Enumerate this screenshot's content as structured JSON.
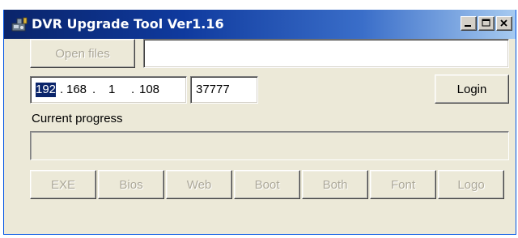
{
  "window": {
    "title": "DVR Upgrade Tool Ver1.16",
    "app_icon": "dvr-tool-icon",
    "title_bar_color": "#0a246a"
  },
  "controls": {
    "open_files_label": "Open files",
    "open_files_enabled": false,
    "file_path_value": "",
    "ip_address": {
      "octets": [
        "192",
        "168",
        "1",
        "108"
      ],
      "selected_octet": 0
    },
    "port_value": "37777",
    "login_label": "Login",
    "progress_label": "Current progress",
    "progress_value": 0
  },
  "upgrade_buttons": [
    {
      "label": "EXE",
      "enabled": false
    },
    {
      "label": "Bios",
      "enabled": false
    },
    {
      "label": "Web",
      "enabled": false
    },
    {
      "label": "Boot",
      "enabled": false
    },
    {
      "label": "Both",
      "enabled": false
    },
    {
      "label": "Font",
      "enabled": false
    },
    {
      "label": "Logo",
      "enabled": false
    }
  ],
  "icons": {
    "minimize": "minimize-icon",
    "maximize": "maximize-icon",
    "close": "close-icon"
  }
}
